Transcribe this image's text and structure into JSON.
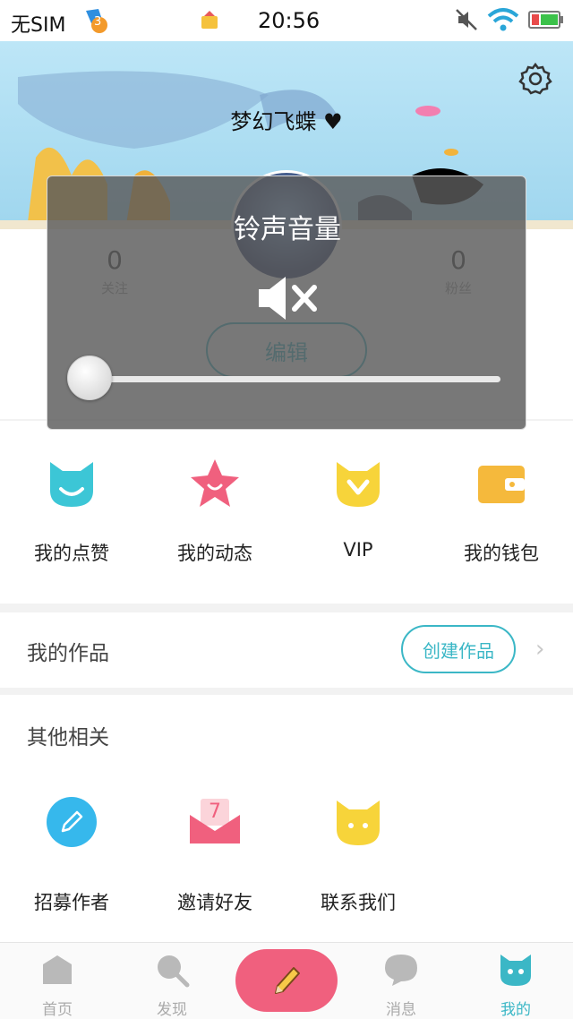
{
  "status_bar": {
    "carrier": "无SIM",
    "notification_count": "3",
    "time": "20:56"
  },
  "profile": {
    "username": "梦幻飞蝶",
    "following_count": "0",
    "following_label": "关注",
    "followers_count": "0",
    "followers_label": "粉丝",
    "edit_label": "编辑"
  },
  "quick_menu": [
    {
      "label": "我的点赞",
      "icon": "cat-smile-icon",
      "color": "#3cc6d6"
    },
    {
      "label": "我的动态",
      "icon": "star-icon",
      "color": "#f0607e"
    },
    {
      "label": "VIP",
      "icon": "vip-cat-icon",
      "color": "#f7d43a"
    },
    {
      "label": "我的钱包",
      "icon": "wallet-icon",
      "color": "#f5b93c"
    }
  ],
  "works": {
    "title": "我的作品",
    "create_label": "创建作品"
  },
  "others": {
    "title": "其他相关",
    "items": [
      {
        "label": "招募作者",
        "icon": "pencil-icon"
      },
      {
        "label": "邀请好友",
        "icon": "envelope-icon",
        "badge": "7"
      },
      {
        "label": "联系我们",
        "icon": "cat-contact-icon"
      }
    ]
  },
  "tabs": [
    {
      "label": "首页",
      "icon": "home-icon",
      "active": false
    },
    {
      "label": "发现",
      "icon": "search-icon",
      "active": false
    },
    {
      "label": "消息",
      "icon": "message-icon",
      "active": false
    },
    {
      "label": "我的",
      "icon": "cat-profile-icon",
      "active": true
    }
  ],
  "volume_overlay": {
    "title": "铃声音量",
    "level": 0
  },
  "colors": {
    "accent": "#3bb7c6",
    "pink": "#f0607e"
  }
}
